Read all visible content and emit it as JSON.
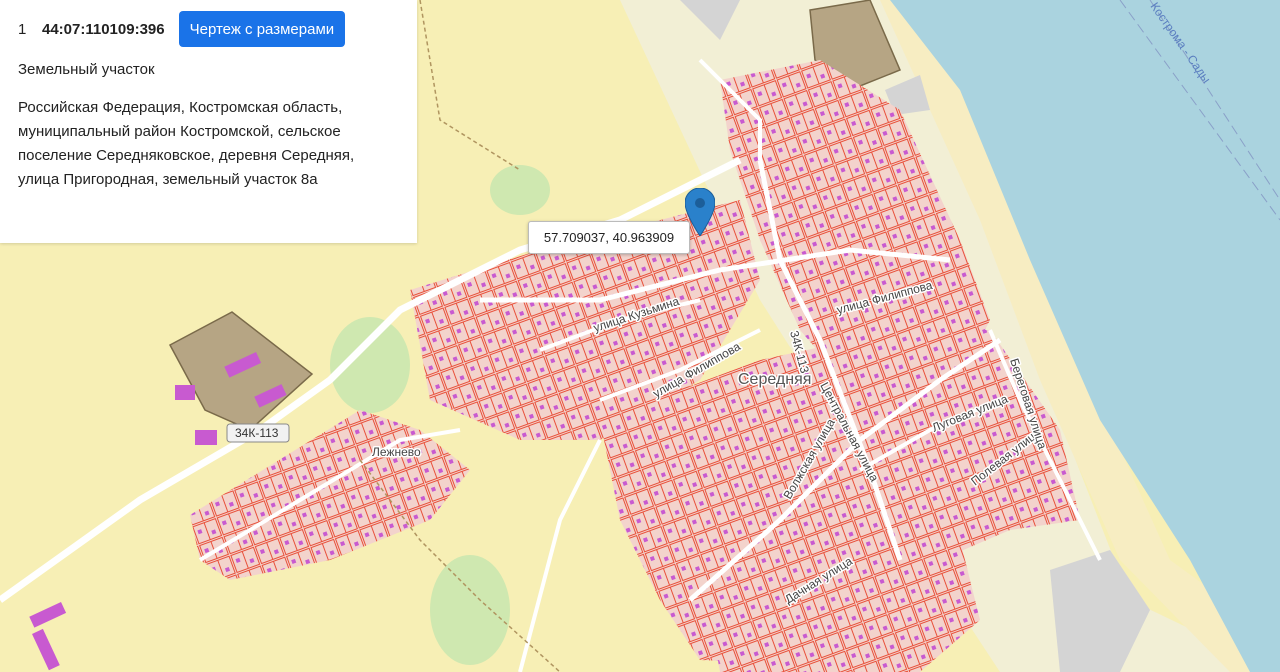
{
  "info_panel": {
    "row_index": "1",
    "cadastral_number": "44:07:110109:396",
    "drawing_button_label": "Чертеж с размерами",
    "object_type": "Земельный участок",
    "address": "Российская Федерация, Костромская область, муниципальный район Костромской, сельское поселение Середняковское, деревня Середняя, улица Пригородная, земельный участок 8а"
  },
  "popup": {
    "coordinates": "57.709037, 40.963909"
  },
  "map": {
    "road_badge": "34К-113",
    "labels": {
      "settlement_main": "Середняя",
      "settlement_left": "Лежнево",
      "river": "Кострома - Сады",
      "street_kuzmina": "улица Кузьмина",
      "street_filippova_1": "улица Филиппова",
      "street_filippova_2": "улица Филиппова",
      "street_central": "Центральная улица",
      "street_volzhskaya": "Волжская улица",
      "street_lugovaya": "Луговая улица",
      "street_polevaya": "Полевая улица",
      "street_beregovaya": "Береговая улица",
      "street_dachnaya": "Дачная улица",
      "road_34k": "34К-113"
    },
    "colors": {
      "water": "#aad3df",
      "parcel_stroke": "#e8503a",
      "building": "#c85ad0",
      "field": "#f7efb5",
      "green": "#c8e6a0",
      "marker": "#2a81cb"
    }
  }
}
